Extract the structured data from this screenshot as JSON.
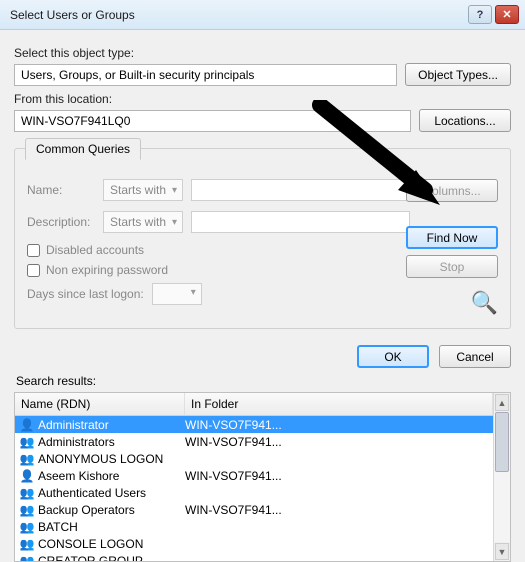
{
  "title": "Select Users or Groups",
  "labels": {
    "object_type": "Select this object type:",
    "location": "From this location:",
    "tab": "Common Queries",
    "name": "Name:",
    "description": "Description:",
    "disabled_accounts": "Disabled accounts",
    "non_expiring": "Non expiring password",
    "days_since": "Days since last logon:",
    "search_results": "Search results:",
    "col_name": "Name (RDN)",
    "col_folder": "In Folder"
  },
  "values": {
    "object_type": "Users, Groups, or Built-in security principals",
    "location": "WIN-VSO7F941LQ0",
    "name_mode": "Starts with",
    "desc_mode": "Starts with",
    "name_text": "",
    "desc_text": ""
  },
  "buttons": {
    "object_types": "Object Types...",
    "locations": "Locations...",
    "columns": "Columns...",
    "find_now": "Find Now",
    "stop": "Stop",
    "ok": "OK",
    "cancel": "Cancel"
  },
  "results": [
    {
      "name": "Administrator",
      "folder": "WIN-VSO7F941...",
      "icon": "👤",
      "selected": true
    },
    {
      "name": "Administrators",
      "folder": "WIN-VSO7F941...",
      "icon": "👥",
      "selected": false
    },
    {
      "name": "ANONYMOUS LOGON",
      "folder": "",
      "icon": "👥",
      "selected": false
    },
    {
      "name": "Aseem Kishore",
      "folder": "WIN-VSO7F941...",
      "icon": "👤",
      "selected": false
    },
    {
      "name": "Authenticated Users",
      "folder": "",
      "icon": "👥",
      "selected": false
    },
    {
      "name": "Backup Operators",
      "folder": "WIN-VSO7F941...",
      "icon": "👥",
      "selected": false
    },
    {
      "name": "BATCH",
      "folder": "",
      "icon": "👥",
      "selected": false
    },
    {
      "name": "CONSOLE LOGON",
      "folder": "",
      "icon": "👥",
      "selected": false
    },
    {
      "name": "CREATOR GROUP",
      "folder": "",
      "icon": "👥",
      "selected": false
    }
  ]
}
